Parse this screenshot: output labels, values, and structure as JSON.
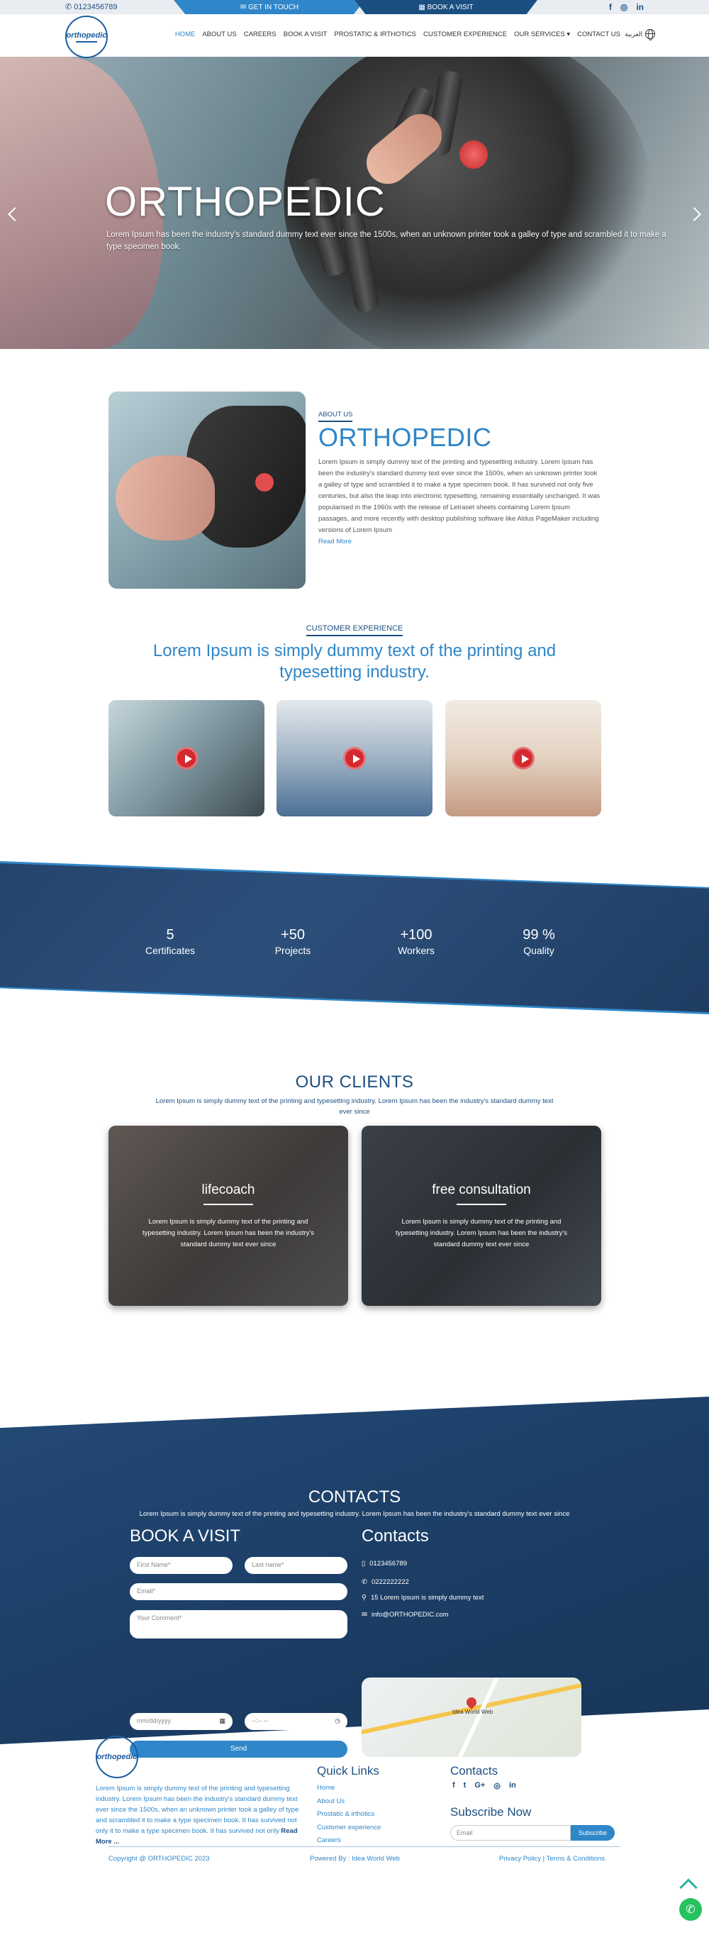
{
  "topbar": {
    "phone": "0123456789",
    "get_in_touch": "GET IN TOUCH",
    "book_visit": "BOOK A VISIT",
    "phone_icon": "phone-icon",
    "social_icons": [
      "facebook-icon",
      "instagram-icon",
      "linkedin-icon"
    ]
  },
  "nav": {
    "logo_text": "orthopedic",
    "items": [
      "HOME",
      "ABOUT US",
      "CAREERS",
      "BOOK A VISIT",
      "PROSTATIC & IRTHOTICS",
      "CUSTOMER EXPERIENCE",
      "OUR SERVICES ▾",
      "CONTACT US"
    ],
    "active": "HOME",
    "lang": "العربية"
  },
  "hero": {
    "title": "ORTHOPEDIC",
    "text": "Lorem Ipsum has been the industry's standard dummy text ever since the 1500s, when an unknown printer took a galley of type and scrambled it to make a type specimen book."
  },
  "about": {
    "label": "ABOUT US",
    "title": "ORTHOPEDIC",
    "text": "Lorem Ipsum is simply dummy text of the printing and typesetting industry. Lorem Ipsum has been the industry's standard dummy text ever since the 1500s, when an unknown printer took a galley of type and scrambled it to make a type specimen book. It has survived not only five centuries, but also the leap into electronic typesetting, remaining essentially unchanged. It was popularised in the 1960s with the release of Letraset sheets containing Lorem Ipsum passages, and more recently with desktop publishing software like Aldus PageMaker including versions of Lorem Ipsum",
    "read_more": "Read More"
  },
  "customer_experience": {
    "label": "CUSTOMER EXPERIENCE",
    "title": "Lorem Ipsum is simply dummy text of the printing and typesetting industry."
  },
  "stats": [
    {
      "number": "5",
      "label": "Certificates"
    },
    {
      "number": "+50",
      "label": "Projects"
    },
    {
      "number": "+100",
      "label": "Workers"
    },
    {
      "number": "99 %",
      "label": "Quality"
    }
  ],
  "clients": {
    "title": "OUR CLIENTS",
    "subtitle": "Lorem Ipsum is simply dummy text of the printing and typesetting industry. Lorem Ipsum has been the industry's standard dummy text ever since",
    "cards": [
      {
        "title": "lifecoach",
        "text": "Lorem Ipsum is simply dummy text of the printing and typesetting industry. Lorem Ipsum has been the industry's standard dummy text ever since"
      },
      {
        "title": "free consultation",
        "text": "Lorem Ipsum is simply dummy text of the printing and typesetting industry. Lorem Ipsum has been the industry's standard dummy text ever since"
      }
    ]
  },
  "contacts": {
    "title": "CONTACTS",
    "subtitle": "Lorem Ipsum is simply dummy text of the printing and typesetting industry. Lorem Ipsum has been the industry's standard dummy text ever since",
    "book_title": "BOOK A VISIT",
    "contacts_title": "Contacts",
    "first_name": "First Name*",
    "last_name": "Last name*",
    "email": "Email*",
    "comment": "Your Comment*",
    "date": "mm/dd/yyyy",
    "time": "--:-- --",
    "send": "Send",
    "mobile": "0123456789",
    "phone": "0222222222",
    "address": "15 Lorem Ipsum is simply dummy text",
    "mail": "info@ORTHOPEDIC.com",
    "map_label": "Idea World Web"
  },
  "footer": {
    "logo_text": "orthopedic",
    "text": "Lorem Ipsum is simply dummy text of the printing and typesetting industry. Lorem Ipsum has been the industry's standard dummy text ever since the 1500s, when an unknown printer took a galley of type and scrambled it to make a type specimen book. It has survived not only it to make a type specimen book. It has survived not only",
    "read_more": "Read More ...",
    "quick_links_title": "Quick Links",
    "quick_links": [
      "Home",
      "About Us",
      "Prostatic & irthotics",
      "Customer experience",
      "Careers"
    ],
    "contacts_title": "Contacts",
    "social_icons": [
      "facebook-icon",
      "twitter-icon",
      "google-plus-icon",
      "instagram-icon",
      "linkedin-icon"
    ],
    "subscribe_title": "Subscribe Now",
    "email_placeholder": "Email",
    "subscribe_button": "Subscribe",
    "copyright": "Copyright @ ORTHOPEDIC 2023",
    "powered": "Powered By : Idea World Web",
    "policy": "Privacy Policy | Terms & Conditions"
  }
}
